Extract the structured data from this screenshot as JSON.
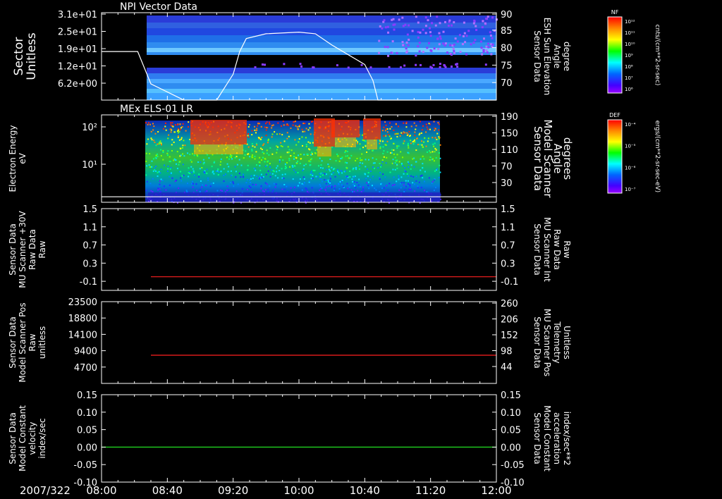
{
  "colors": {
    "background": "#000000",
    "axis": "#ffffff",
    "red": "#ff2020",
    "green": "#22dd22",
    "white": "#ffffff"
  },
  "chart_data": [
    {
      "type": "heatmap",
      "title": "NPI Vector Data",
      "ylabel_left": [
        "Sector",
        "Unitless"
      ],
      "ylabel_right": [
        "Sensor Data",
        "ESH Sun Elevation",
        "Angle",
        "degree"
      ],
      "left_ticks": [
        "3.1e+01",
        "2.5e+01",
        "1.9e+01",
        "1.2e+01",
        "6.2e+00"
      ],
      "right_ticks": [
        "90",
        "85",
        "80",
        "75",
        "70"
      ],
      "right_ylim": [
        65,
        90
      ],
      "overlay_line": {
        "color": "#ffffff",
        "x": [
          "08:00",
          "08:22",
          "08:30",
          "08:50",
          "09:00",
          "09:10",
          "09:20",
          "09:24",
          "09:28",
          "09:40",
          "10:00",
          "10:10",
          "10:20",
          "10:30",
          "10:40",
          "10:45",
          "10:48",
          "12:00"
        ],
        "y": [
          80,
          80,
          70,
          65,
          65,
          65,
          73,
          80,
          84,
          85.5,
          86,
          85.5,
          82,
          79,
          76,
          71,
          65,
          65
        ]
      },
      "colorbar": {
        "label": "NF",
        "unit": "cnts/(cm**2-sr-sec)",
        "ticks": [
          "10¹²",
          "10¹¹",
          "10¹⁰",
          "10⁹",
          "10⁸",
          "10⁷",
          "10⁶"
        ]
      }
    },
    {
      "type": "heatmap",
      "title": "MEx ELS-01 LR",
      "ylabel_left": [
        "Electron Energy",
        "eV"
      ],
      "ylabel_right": [
        "Sensor Data",
        "Model Scanner",
        "Angle",
        "degrees"
      ],
      "left_ticks": [
        "10²",
        "10¹"
      ],
      "right_ticks": [
        "190",
        "150",
        "110",
        "70",
        "30"
      ],
      "overlay_line": {
        "color": "#ffffff",
        "x": [
          "08:00",
          "12:00"
        ],
        "y": [
          12,
          12
        ]
      },
      "colorbar": {
        "label": "DEF",
        "unit": "ergs/(cm**2-sr-sec-eV)",
        "ticks": [
          "10⁻⁴",
          "10⁻⁵",
          "10⁻⁶",
          "10⁻⁷"
        ]
      }
    },
    {
      "type": "line",
      "ylabel_left": [
        "Sensor Data",
        "MU Scanner +30V",
        "Raw Data",
        "Raw"
      ],
      "ylabel_right": [
        "Sensor Data",
        "MU Scanner Int",
        "Raw Data",
        "Raw"
      ],
      "left_ticks": [
        "1.5",
        "1.1",
        "0.7",
        "0.3",
        "-0.1"
      ],
      "right_ticks": [
        "1.5",
        "1.1",
        "0.7",
        "0.3",
        "-0.1"
      ],
      "ylim": [
        -0.3,
        1.5
      ],
      "series": [
        {
          "color": "#ff2020",
          "x": [
            "08:30",
            "12:00"
          ],
          "y": [
            0.0,
            0.0
          ]
        }
      ]
    },
    {
      "type": "line",
      "ylabel_left": [
        "Sensor Data",
        "Model Scanner Pos",
        "Raw",
        "unitless"
      ],
      "ylabel_right": [
        "Sensor Data",
        "MU Scanner Pos",
        "Telemetry",
        "Unitless"
      ],
      "left_ticks": [
        "23500",
        "18800",
        "14100",
        "9400",
        "4700"
      ],
      "right_ticks": [
        "260",
        "206",
        "152",
        "98",
        "44"
      ],
      "ylim": [
        0,
        23500
      ],
      "series": [
        {
          "color": "#ff2020",
          "x": [
            "08:30",
            "12:00"
          ],
          "y": [
            8100,
            8100
          ]
        }
      ]
    },
    {
      "type": "line",
      "ylabel_left": [
        "Sensor Data",
        "Model Constant",
        "velocity",
        "index/sec"
      ],
      "ylabel_right": [
        "Sensor Data",
        "Model Constant",
        "acceleration",
        "index/sec**2"
      ],
      "left_ticks": [
        "0.15",
        "0.10",
        "0.05",
        "0.00",
        "-0.05",
        "-0.10"
      ],
      "right_ticks": [
        "0.15",
        "0.10",
        "0.05",
        "0.00",
        "-0.05",
        "-0.10"
      ],
      "ylim": [
        -0.1,
        0.15
      ],
      "series": [
        {
          "color": "#22dd22",
          "x": [
            "08:00",
            "12:00"
          ],
          "y": [
            0,
            0
          ]
        }
      ]
    }
  ],
  "x_axis": {
    "date": "2007/322",
    "ticks": [
      "08:00",
      "08:40",
      "09:20",
      "10:00",
      "10:40",
      "11:20",
      "12:00"
    ]
  }
}
